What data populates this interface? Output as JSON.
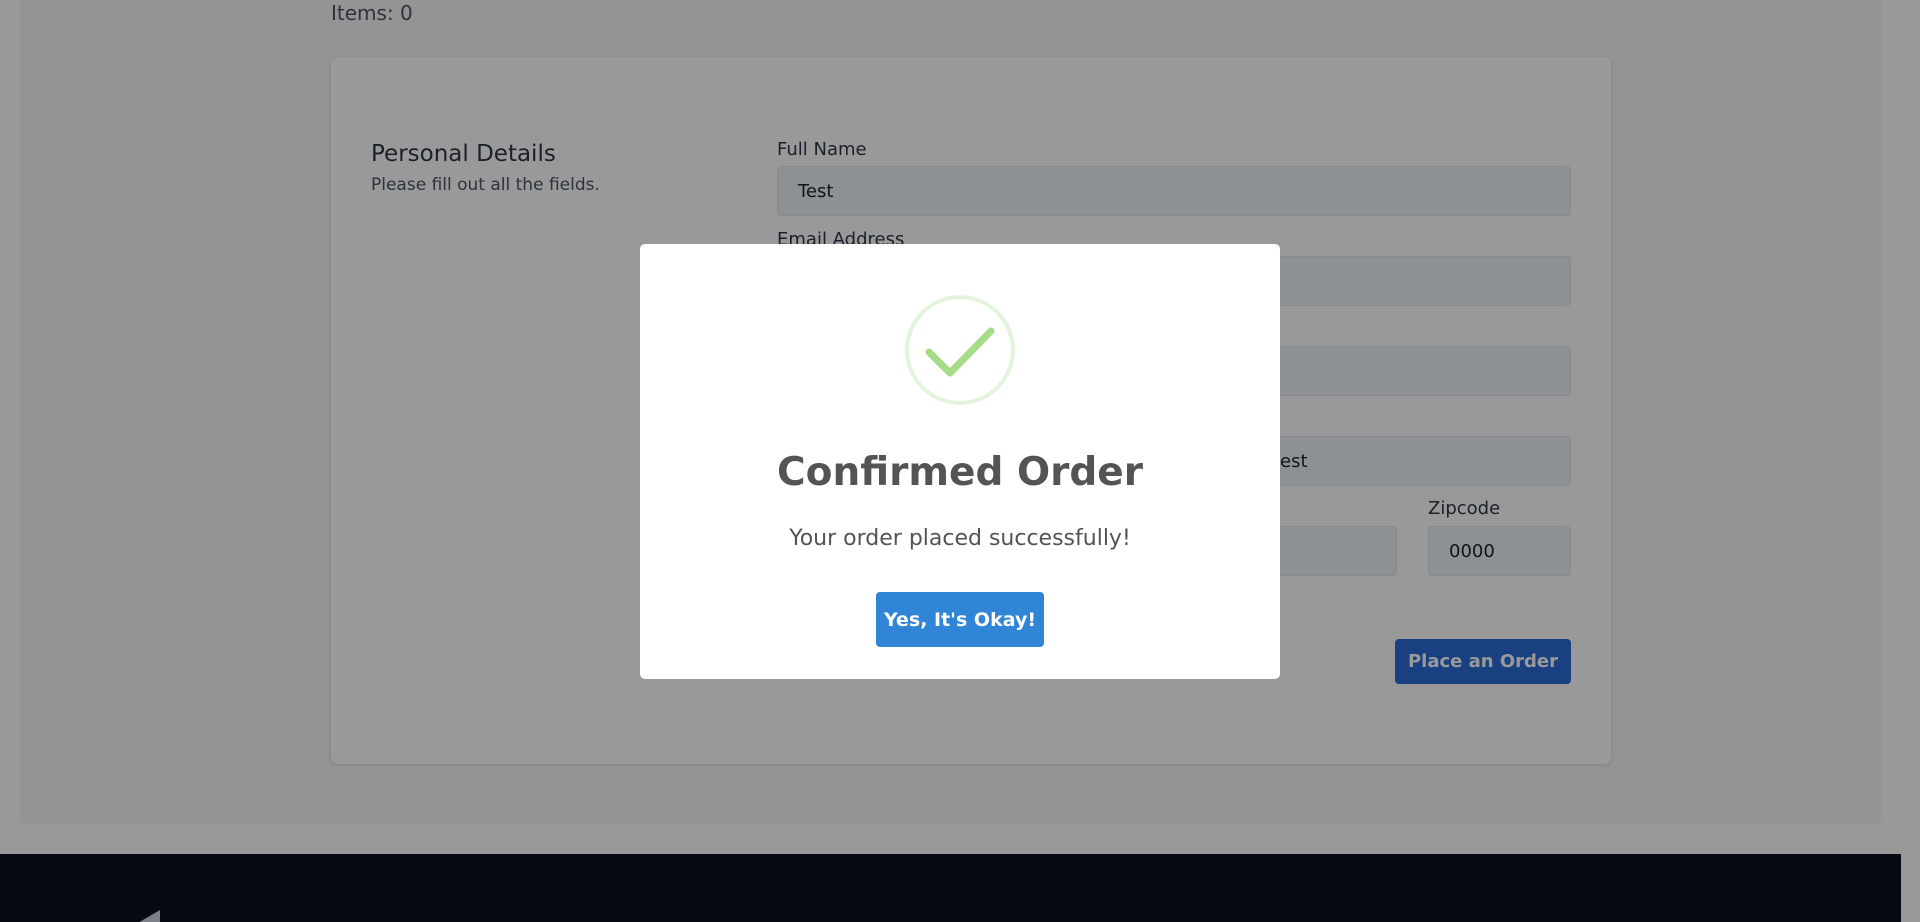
{
  "cart": {
    "items_label": "Items: 0"
  },
  "form": {
    "section_title": "Personal Details",
    "section_subtitle": "Please fill out all the fields.",
    "full_name_label": "Full Name",
    "full_name_value": "Test",
    "email_label": "Email Address",
    "address_value_visible": "est",
    "zipcode_label": "Zipcode",
    "zipcode_value": "0000",
    "place_order_label": "Place an Order"
  },
  "modal": {
    "icon": "check-circle-icon",
    "title": "Confirmed Order",
    "message": "Your order placed successfully!",
    "confirm_label": "Yes, It's Okay!"
  },
  "colors": {
    "accent": "#3085d6",
    "success": "#a5dc86",
    "footer": "#0b1120"
  }
}
